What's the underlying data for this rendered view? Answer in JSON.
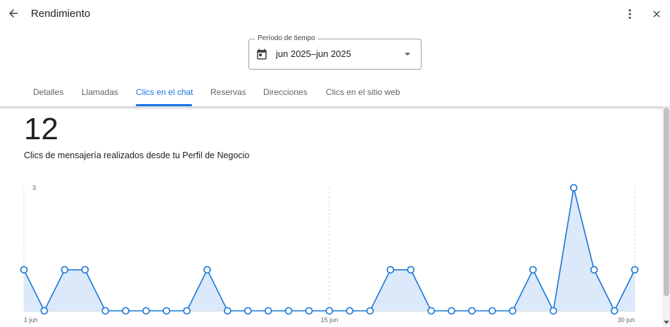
{
  "header": {
    "title": "Rendimiento",
    "back_icon": "arrow-back-icon",
    "more_icon": "more-vert-icon",
    "close_icon": "close-icon"
  },
  "period": {
    "label": "Período de tiempo",
    "value": "jun 2025–jun 2025",
    "icon": "calendar-icon"
  },
  "tabs": [
    {
      "label": "Detalles",
      "active": false
    },
    {
      "label": "Llamadas",
      "active": false
    },
    {
      "label": "Clics en el chat",
      "active": true
    },
    {
      "label": "Reservas",
      "active": false
    },
    {
      "label": "Direcciones",
      "active": false
    },
    {
      "label": "Clics en el sitio web",
      "active": false
    }
  ],
  "metric": {
    "value": "12",
    "description": "Clics de mensajería realizados desde tu Perfil de Negocio"
  },
  "colors": {
    "accent": "#1a73e8",
    "line": "#1976d2",
    "area": "#dbe9fb"
  },
  "chart_data": {
    "type": "area",
    "x": [
      "1 jun",
      "2 jun",
      "3 jun",
      "4 jun",
      "5 jun",
      "6 jun",
      "7 jun",
      "8 jun",
      "9 jun",
      "10 jun",
      "11 jun",
      "12 jun",
      "13 jun",
      "14 jun",
      "15 jun",
      "16 jun",
      "17 jun",
      "18 jun",
      "19 jun",
      "20 jun",
      "21 jun",
      "22 jun",
      "23 jun",
      "24 jun",
      "25 jun",
      "26 jun",
      "27 jun",
      "28 jun",
      "29 jun",
      "30 jun"
    ],
    "values": [
      1,
      0,
      1,
      1,
      0,
      0,
      0,
      0,
      0,
      1,
      0,
      0,
      0,
      0,
      0,
      0,
      0,
      0,
      1,
      1,
      0,
      0,
      0,
      0,
      0,
      1,
      0,
      3,
      1,
      0,
      1
    ],
    "x_tick_labels": [
      "1 jun",
      "15 jun",
      "30 jun"
    ],
    "y_tick_labels": [
      "3"
    ],
    "ylim": [
      0,
      3
    ],
    "grid": "vertical dashed at 1 jun, 15 jun, 30 jun"
  }
}
